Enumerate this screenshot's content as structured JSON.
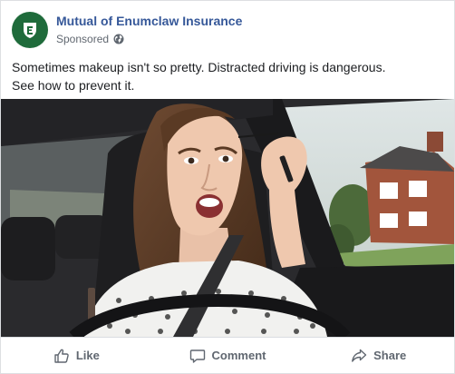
{
  "post": {
    "page_name": "Mutual of Enumclaw Insurance",
    "sponsored_label": "Sponsored",
    "caption_line1": "Sometimes makeup isn't so pretty. Distracted driving is dangerous.",
    "caption_line2": "See how to prevent it."
  },
  "icons": {
    "avatar": "enumclaw-shield-logo",
    "audience": "globe-icon",
    "like": "thumbs-up-icon",
    "comment": "speech-bubble-icon",
    "share": "share-arrow-icon"
  },
  "actions": {
    "like_label": "Like",
    "comment_label": "Comment",
    "share_label": "Share"
  },
  "colors": {
    "page_name": "#365899",
    "meta_text": "#606770",
    "body_text": "#1c1e21",
    "avatar_bg": "#1f6b3b"
  }
}
